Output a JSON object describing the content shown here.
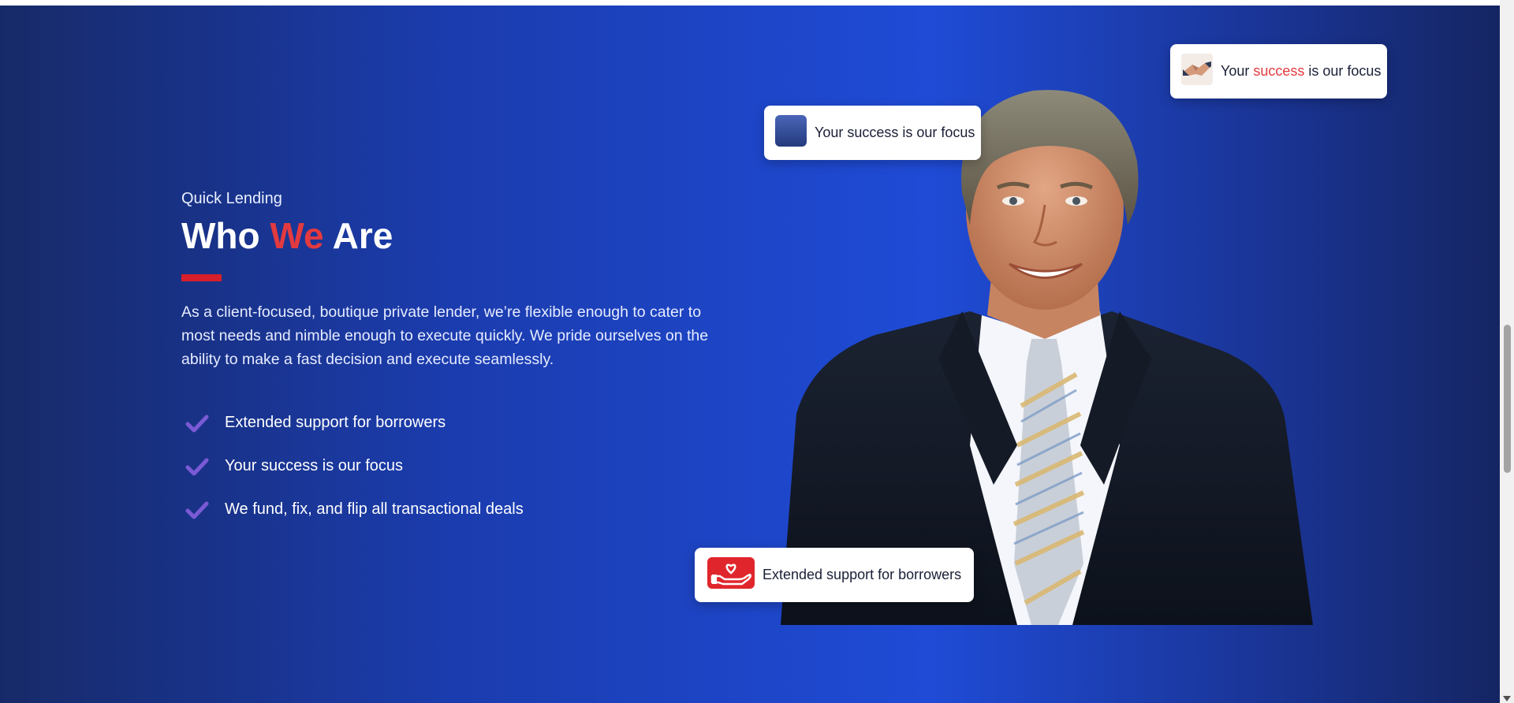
{
  "section": {
    "eyebrow": "Quick Lending",
    "heading": {
      "part1": "Who ",
      "accent": "We",
      "part2": " Are"
    },
    "paragraph": "As a client-focused, boutique private lender, we’re flexible enough to cater to most needs and nimble enough to execute quickly. We pride ourselves on the ability to make a fast decision and execute seamlessly.",
    "checklist": [
      "Extended support for borrowers",
      "Your success is our focus",
      "We fund, fix, and flip all transactional deals"
    ]
  },
  "cards": {
    "focus_card": {
      "text": "Your success is our focus",
      "icon": "blue-square-icon"
    },
    "handshake_card": {
      "pre": "Your ",
      "accent": "success",
      "post": " is our focus",
      "icon": "handshake-icon"
    },
    "support_card": {
      "text": "Extended support for borrowers",
      "icon": "hand-heart-icon"
    }
  },
  "colors": {
    "accent_red": "#e33a3f",
    "check_purple": "#7b5ad6",
    "background_blue": "#1f4bd6"
  }
}
